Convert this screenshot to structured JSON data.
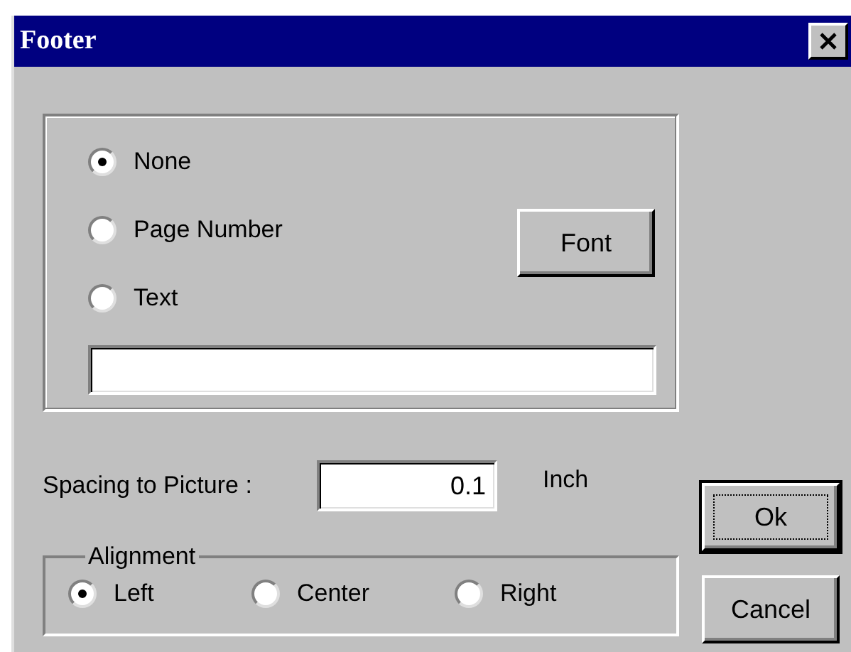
{
  "window": {
    "title": "Footer"
  },
  "footer_type": {
    "options": [
      {
        "label": "None",
        "selected": true
      },
      {
        "label": "Page Number",
        "selected": false
      },
      {
        "label": "Text",
        "selected": false
      }
    ],
    "font_button": "Font"
  },
  "spacing": {
    "label": "Spacing to Picture :",
    "value": "0.1",
    "unit": "Inch"
  },
  "alignment": {
    "title": "Alignment",
    "options": [
      {
        "label": "Left",
        "selected": true
      },
      {
        "label": "Center",
        "selected": false
      },
      {
        "label": "Right",
        "selected": false
      }
    ]
  },
  "buttons": [
    {
      "label": "Ok",
      "default": true
    },
    {
      "label": "Cancel",
      "default": false
    }
  ]
}
